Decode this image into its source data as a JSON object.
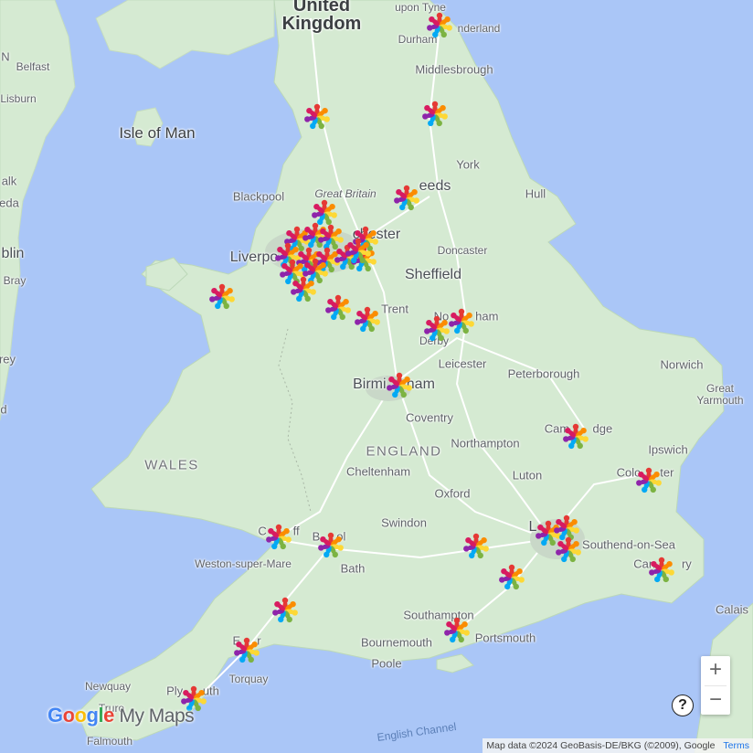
{
  "map": {
    "country_label": "United\nKingdom",
    "labels": {
      "upon_tyne": "upon Tyne",
      "sunderland": "nderland",
      "durham": "Durham",
      "middlesbrough": "Middlesbrough",
      "belfast": "Belfast",
      "lisburn": "Lisburn",
      "n_left": "N",
      "isle_of_man": "Isle of Man",
      "york": "York",
      "blackpool": "Blackpool",
      "great_britain": "Great Britain",
      "leeds": "eeds",
      "hull": "Hull",
      "blin": "blin",
      "bray": "Bray",
      "liverpool": "Liverpo",
      "manchester": "chester",
      "doncaster": "Doncaster",
      "sheffield": "Sheffield",
      "trent": "Trent",
      "nottingham": "No        ham",
      "derby": "Derby",
      "leicester": "Leicester",
      "peterborough": "Peterborough",
      "norwich": "Norwich",
      "great_yarmouth": "Great\nYarmouth",
      "birmingham": "Birmi     ham",
      "coventry": "Coventry",
      "cambridge": "Cam       dge",
      "england": "ENGLAND",
      "northampton": "Northampton",
      "ipswich": "Ipswich",
      "wales": "WALES",
      "cheltenham": "Cheltenham",
      "luton": "Luton",
      "colchester": "Colc      ter",
      "oxford": "Oxford",
      "swindon": "Swindon",
      "london": "L",
      "southend": "Southend-on-Sea",
      "cardiff": "C        ff",
      "bristol": "B     ol",
      "weston": "Weston-super-Mare",
      "bath": "Bath",
      "canterbury": "Can        ry",
      "calais": "Calais",
      "southampton": "Southampton",
      "portsmouth": "Portsmouth",
      "bournemouth": "Bournemouth",
      "poole": "Poole",
      "exeter": "E     r",
      "torquay": "Torquay",
      "newquay": "Newquay",
      "plymouth": "Ply      uth",
      "truro": "Truro",
      "falmouth": "Falmouth",
      "english_channel": "English Channel",
      "alk": "alk",
      "eda": "eda",
      "rey": "rey",
      "d": "d"
    },
    "marker_icon": "people-circle-marker-icon",
    "marker_count": 38
  },
  "controls": {
    "zoom_in": "+",
    "zoom_out": "−",
    "help": "?"
  },
  "branding": {
    "google_letters": [
      "G",
      "o",
      "o",
      "g",
      "l",
      "e"
    ],
    "google_colors": [
      "#4285f4",
      "#ea4335",
      "#fbbc05",
      "#4285f4",
      "#34a853",
      "#ea4335"
    ],
    "product": "My Maps"
  },
  "footer": {
    "attribution": "Map data ©2024 GeoBasis-DE/BKG (©2009), Google",
    "terms": "Terms"
  },
  "colors": {
    "sea": "#aac6f7",
    "land": "#d5ead2",
    "road": "#ffffff",
    "marker_petals": [
      "#e53935",
      "#fb8c00",
      "#fdd835",
      "#7cb342",
      "#03a9f4",
      "#8e24aa",
      "#d81b60"
    ]
  }
}
